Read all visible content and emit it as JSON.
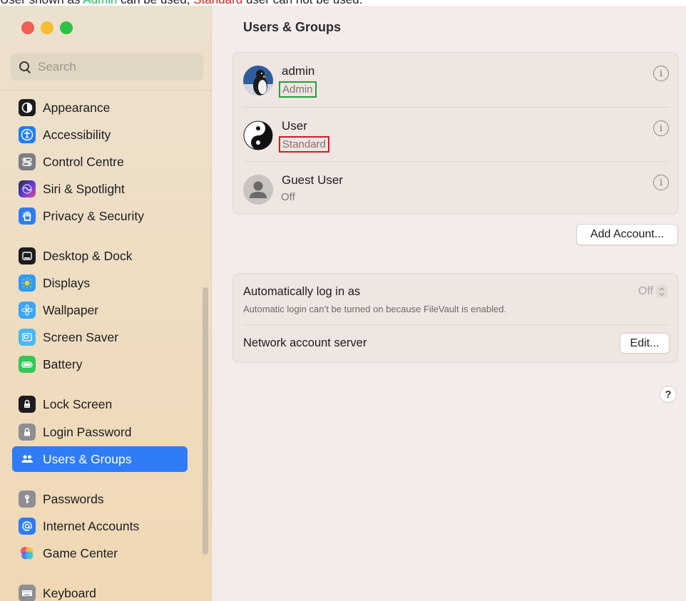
{
  "caption": {
    "part1": "User shown as ",
    "admin_word": "Admin",
    "part2": " can be used, ",
    "standard_word": "Standard",
    "part3": " user can not be used."
  },
  "sidebar": {
    "search_placeholder": "Search",
    "items": [
      {
        "label": "Appearance",
        "icon": "appearance-icon",
        "color": "#1c1c1e"
      },
      {
        "label": "Accessibility",
        "icon": "accessibility-icon",
        "color": "#1f7ef5"
      },
      {
        "label": "Control Centre",
        "icon": "control-centre-icon",
        "color": "#7d7d82"
      },
      {
        "label": "Siri & Spotlight",
        "icon": "siri-icon",
        "color": "#5b3ad8"
      },
      {
        "label": "Privacy & Security",
        "icon": "hand-icon",
        "color": "#2f7cf6"
      },
      {
        "label": "Desktop & Dock",
        "icon": "dock-icon",
        "color": "#1c1c1e"
      },
      {
        "label": "Displays",
        "icon": "sun-icon",
        "color": "#2f9bf7"
      },
      {
        "label": "Wallpaper",
        "icon": "flower-icon",
        "color": "#3aa6f6"
      },
      {
        "label": "Screen Saver",
        "icon": "screen-saver-icon",
        "color": "#47b9f2"
      },
      {
        "label": "Battery",
        "icon": "battery-icon",
        "color": "#34c759"
      },
      {
        "label": "Lock Screen",
        "icon": "lock-screen-icon",
        "color": "#1c1c1e"
      },
      {
        "label": "Login Password",
        "icon": "lock-icon",
        "color": "#8e8e93"
      },
      {
        "label": "Users & Groups",
        "icon": "users-icon",
        "color": "#2f7cf6"
      },
      {
        "label": "Passwords",
        "icon": "key-icon",
        "color": "#8e8e93"
      },
      {
        "label": "Internet Accounts",
        "icon": "at-icon",
        "color": "#2f7cf6"
      },
      {
        "label": "Game Center",
        "icon": "game-center-icon",
        "color": "#f0505a"
      },
      {
        "label": "Keyboard",
        "icon": "keyboard-icon",
        "color": "#8e8e93"
      }
    ],
    "active_label": "Users & Groups"
  },
  "main": {
    "title": "Users & Groups",
    "users": [
      {
        "name": "admin",
        "role": "Admin",
        "avatar": "penguin-avatar"
      },
      {
        "name": "User",
        "role": "Standard",
        "avatar": "yin-yang-avatar"
      },
      {
        "name": "Guest User",
        "role": "Off",
        "avatar": "guest-avatar"
      }
    ],
    "info_glyph": "i",
    "add_account_label": "Add Account...",
    "auto_login": {
      "label": "Automatically log in as",
      "value": "Off",
      "note": "Automatic login can’t be turned on because FileVault is enabled."
    },
    "network_server": {
      "label": "Network account server",
      "edit_label": "Edit..."
    },
    "help_glyph": "?"
  },
  "colors": {
    "accent": "#2f7cf6",
    "admin_highlight": "#1fa23b",
    "standard_highlight": "#d3192b"
  }
}
